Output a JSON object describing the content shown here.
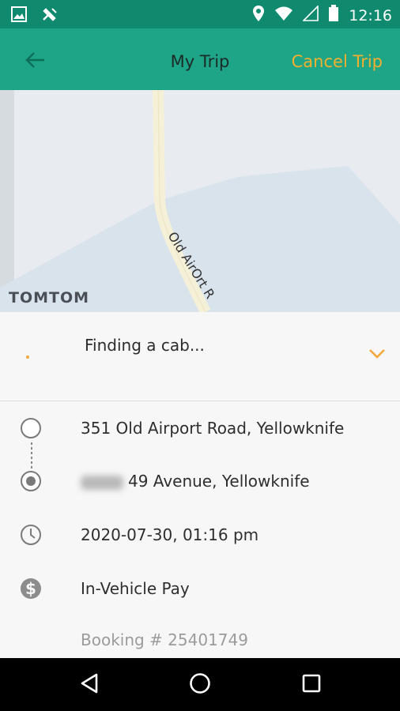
{
  "status_bar": {
    "time": "12:16",
    "left_icons": [
      "image-icon",
      "satellite-icon"
    ],
    "right_icons": [
      "location-pin-icon",
      "wifi-icon",
      "signal-icon",
      "battery-icon"
    ]
  },
  "app_bar": {
    "title": "My Trip",
    "cancel_label": "Cancel Trip",
    "back_icon": "arrow-left-icon",
    "accent_color": "#f2b02e",
    "bar_color": "#1ea486"
  },
  "map": {
    "road_label": "Old AirOrt R",
    "brand": "TOMTOM"
  },
  "trip_status": {
    "text": "Finding a cab...",
    "expand_icon": "chevron-down-icon"
  },
  "trip_details": {
    "pickup": "351 Old Airport Road, Yellowknife",
    "dropoff": "49 Avenue, Yellowknife",
    "datetime": "2020-07-30, 01:16 pm",
    "payment": "In-Vehicle Pay",
    "booking": "Booking # 25401749"
  },
  "nav_bar": {
    "icons": [
      "back-triangle-icon",
      "home-circle-icon",
      "recents-square-icon"
    ]
  }
}
